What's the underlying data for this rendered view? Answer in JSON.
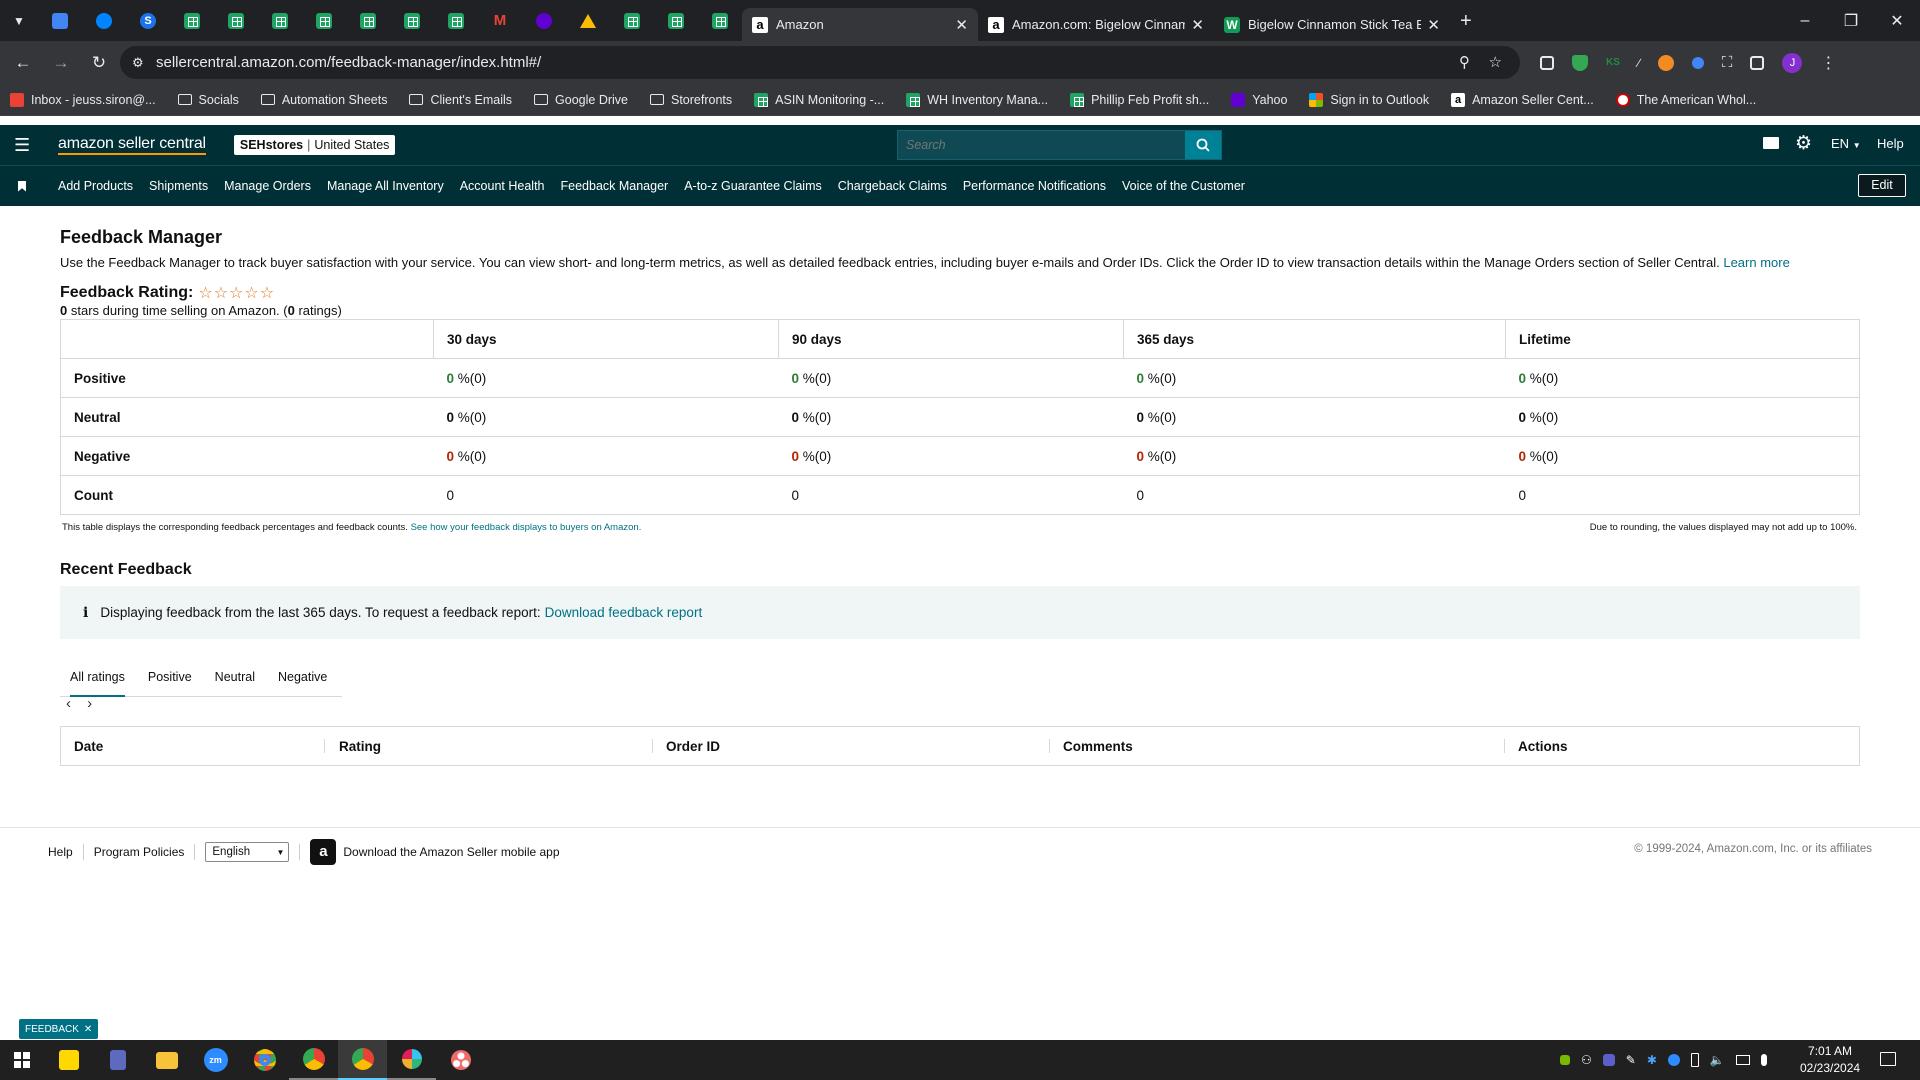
{
  "browser": {
    "tabs": [
      {
        "label": "Amazon",
        "active": true
      },
      {
        "label": "Amazon.com: Bigelow Cinnamo",
        "active": false
      },
      {
        "label": "Bigelow Cinnamon Stick Tea Ba",
        "active": false
      }
    ],
    "url": "sellercentral.amazon.com/feedback-manager/index.html#/",
    "bookmarks": [
      "Inbox - jeuss.siron@...",
      "Socials",
      "Automation Sheets",
      "Client's Emails",
      "Google Drive",
      "Storefronts",
      "ASIN Monitoring -...",
      "WH Inventory Mana...",
      "Phillip Feb Profit sh...",
      "Yahoo",
      "Sign in to Outlook",
      "Amazon Seller Cent...",
      "The American Whol..."
    ]
  },
  "header": {
    "logo": "amazon seller central",
    "store": "SEHstores",
    "marketplace": "United States",
    "search_placeholder": "Search",
    "language": "EN",
    "help": "Help"
  },
  "nav": {
    "links": [
      "Add Products",
      "Shipments",
      "Manage Orders",
      "Manage All Inventory",
      "Account Health",
      "Feedback Manager",
      "A-to-z Guarantee Claims",
      "Chargeback Claims",
      "Performance Notifications",
      "Voice of the Customer"
    ],
    "edit": "Edit"
  },
  "main": {
    "title": "Feedback Manager",
    "description": "Use the Feedback Manager to track buyer satisfaction with your service. You can view short- and long-term metrics, as well as detailed feedback entries, including buyer e-mails and Order IDs. Click the Order ID to view transaction details within the Manage Orders section of Seller Central.",
    "learn_more": "Learn more",
    "rating_label": "Feedback Rating:",
    "stars_filled": 0,
    "stars_total": 5,
    "summary_stars": "0",
    "summary_mid": " stars during time selling on Amazon. (",
    "summary_ratings": "0",
    "summary_end": " ratings)",
    "table": {
      "columns": [
        "30 days",
        "90 days",
        "365 days",
        "Lifetime"
      ],
      "rows": [
        {
          "label": "Positive",
          "values": [
            "0",
            "0",
            "0",
            "0"
          ],
          "suffix": "%(0)",
          "color": "green"
        },
        {
          "label": "Neutral",
          "values": [
            "0",
            "0",
            "0",
            "0"
          ],
          "suffix": "%(0)",
          "color": "neutral"
        },
        {
          "label": "Negative",
          "values": [
            "0",
            "0",
            "0",
            "0"
          ],
          "suffix": "%(0)",
          "color": "red"
        },
        {
          "label": "Count",
          "values": [
            "0",
            "0",
            "0",
            "0"
          ],
          "suffix": "",
          "color": "plain"
        }
      ]
    },
    "table_note": "This table displays the corresponding feedback percentages and feedback counts.",
    "table_note_link": "See how your feedback displays to buyers on Amazon.",
    "rounding_note": "Due to rounding, the values displayed may not add up to 100%.",
    "recent_title": "Recent Feedback",
    "info_text": "Displaying feedback from the last 365 days. To request a feedback report:",
    "info_link": "Download feedback report",
    "tabs": [
      "All ratings",
      "Positive",
      "Neutral",
      "Negative"
    ],
    "feedback_columns": [
      "Date",
      "Rating",
      "Order ID",
      "Comments",
      "Actions"
    ]
  },
  "footer": {
    "help": "Help",
    "policies": "Program Policies",
    "language": "English",
    "app_text": "Download the Amazon Seller mobile app",
    "copyright": "© 1999-2024, Amazon.com, Inc. or its affiliates"
  },
  "feedback_badge": "FEEDBACK",
  "taskbar": {
    "time": "7:01 AM",
    "date": "02/23/2024"
  }
}
